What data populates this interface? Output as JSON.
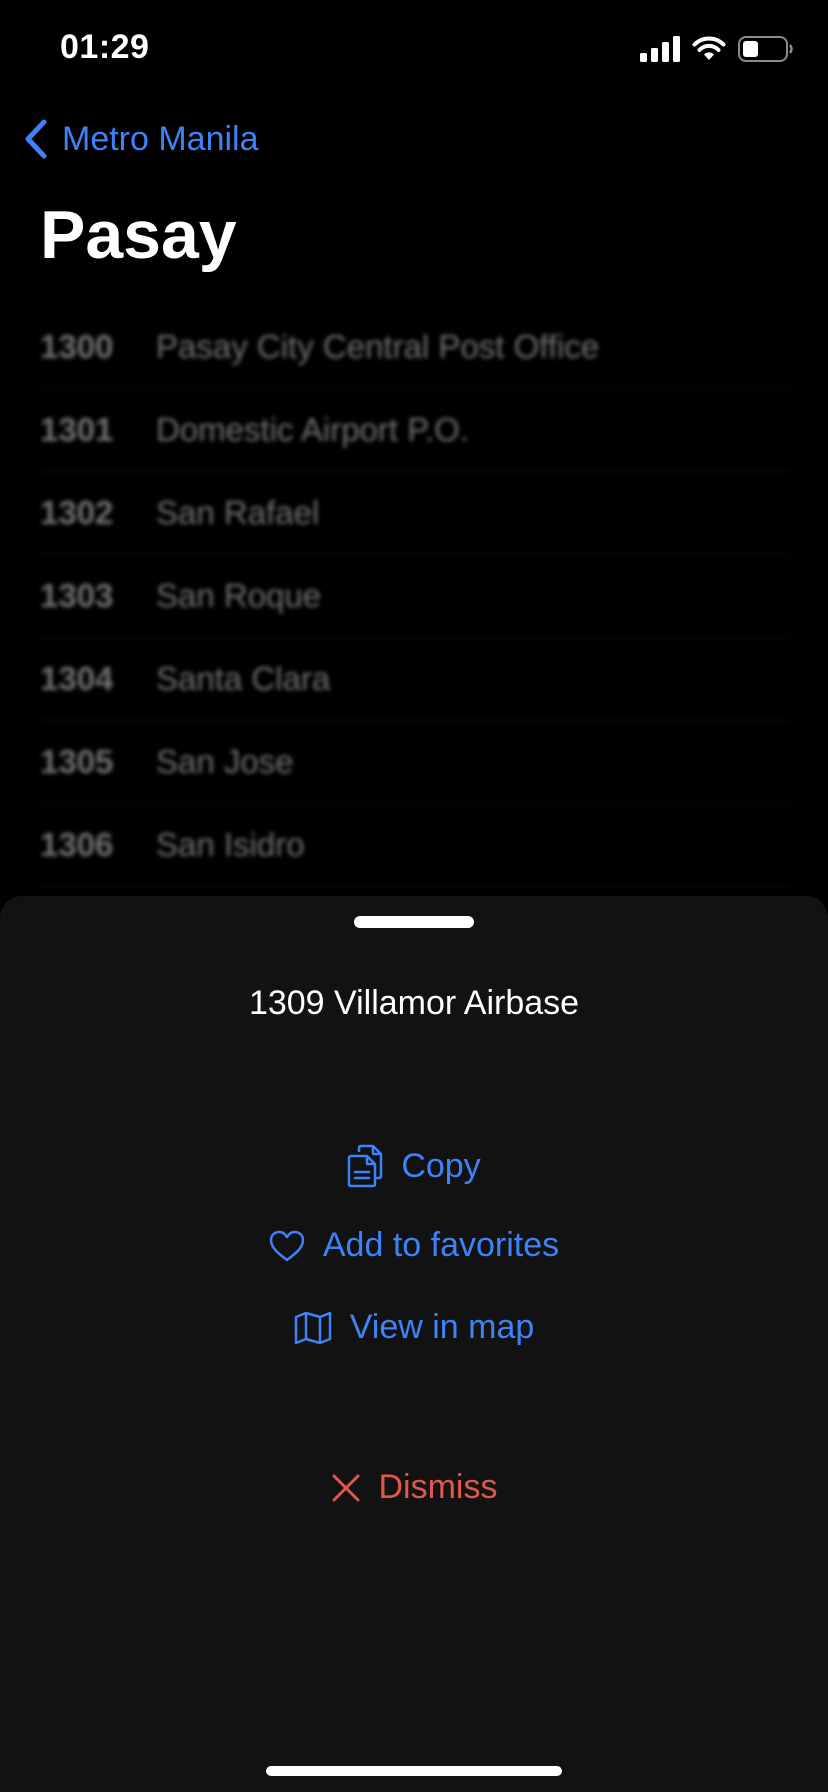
{
  "status_bar": {
    "time": "01:29",
    "icons": [
      "signal-icon",
      "wifi-icon",
      "battery-icon"
    ]
  },
  "nav": {
    "back_label": "Metro Manila",
    "title": "Pasay"
  },
  "list": {
    "items": [
      {
        "code": "1300",
        "name": "Pasay City Central Post Office"
      },
      {
        "code": "1301",
        "name": "Domestic Airport P.O."
      },
      {
        "code": "1302",
        "name": "San Rafael"
      },
      {
        "code": "1303",
        "name": "San Roque"
      },
      {
        "code": "1304",
        "name": "Santa Clara"
      },
      {
        "code": "1305",
        "name": "San Jose"
      },
      {
        "code": "1306",
        "name": "San Isidro"
      }
    ]
  },
  "sheet": {
    "title": "1309 Villamor Airbase",
    "actions": {
      "copy": "Copy",
      "favorite": "Add to favorites",
      "map": "View in map",
      "dismiss": "Dismiss"
    }
  },
  "colors": {
    "accent": "#3e82f7",
    "destructive": "#e2574c",
    "sheet_background": "#121212",
    "background": "#000000"
  }
}
